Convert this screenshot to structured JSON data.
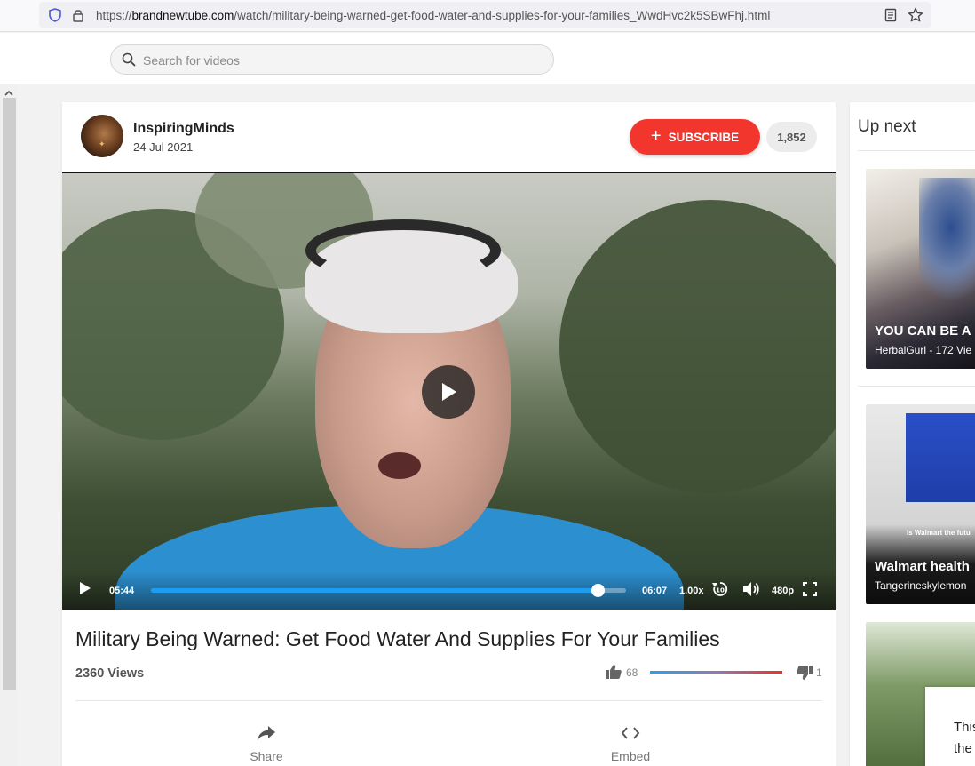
{
  "browser": {
    "url_prefix": "https://",
    "url_host": "brandnewtube.com",
    "url_path": "/watch/military-being-warned-get-food-water-and-supplies-for-your-families_WwdHvc2k5SBwFhj.html"
  },
  "header": {
    "search_placeholder": "Search for videos"
  },
  "channel": {
    "name": "InspiringMinds",
    "date": "24 Jul 2021",
    "subscribe_label": "SUBSCRIBE",
    "subscriber_count": "1,852"
  },
  "player": {
    "current_time": "05:44",
    "duration": "06:07",
    "speed": "1.00x",
    "quality": "480p",
    "progress_fraction": 0.94
  },
  "video": {
    "title": "Military Being Warned: Get Food Water And Supplies For Your Families",
    "views": "2360 Views",
    "likes": "68",
    "dislikes": "1"
  },
  "actions": {
    "share_label": "Share",
    "embed_label": "Embed"
  },
  "sidebar": {
    "heading": "Up next",
    "items": [
      {
        "title": "YOU CAN BE A",
        "meta": "HerbalGurl - 172 Vie"
      },
      {
        "title": "Walmart health",
        "meta": "Tangerineskylemon",
        "caption": "Is Walmart the futu"
      },
      {
        "title": "",
        "meta": ""
      }
    ]
  },
  "popup": {
    "line1": "This",
    "line2": "the"
  },
  "colors": {
    "subscribe": "#f2362e",
    "progress": "#1e9cf0",
    "dislike_bar": "#e8322e"
  }
}
